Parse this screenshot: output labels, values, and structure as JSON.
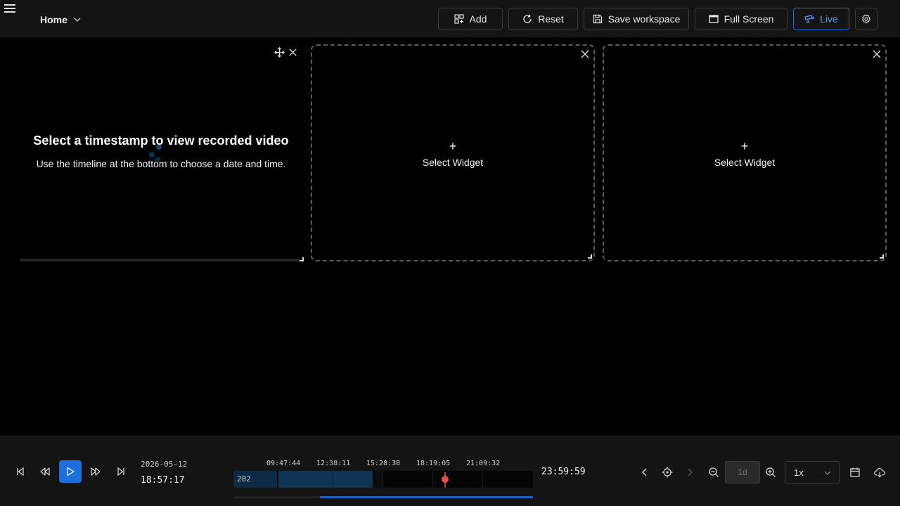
{
  "header": {
    "menu_icon": "hamburger-icon",
    "home_label": "Home",
    "buttons": {
      "add": "Add",
      "reset": "Reset",
      "save": "Save workspace",
      "fullscreen": "Full Screen",
      "live": "Live"
    },
    "accent_color": "#1d6ed8"
  },
  "widgets": {
    "recorded": {
      "title": "Select a timestamp to view recorded video",
      "subtitle": "Use the timeline at the bottom to choose a date and time."
    },
    "slots": [
      {
        "plus": "+",
        "label": "Select Widget"
      },
      {
        "plus": "+",
        "label": "Select Widget"
      }
    ]
  },
  "timeline": {
    "date": "2026-05-12",
    "time": "18:57:17",
    "tick_labels": [
      "09:47:44",
      "12:38:11",
      "15:28:38",
      "18:19:05",
      "21:09:32"
    ],
    "start_label": "202",
    "end_time": "23:59:59",
    "zoom_value": "1d",
    "speed": "1x",
    "playhead_color": "#e74c4c",
    "recording_color": "#0f3555"
  }
}
